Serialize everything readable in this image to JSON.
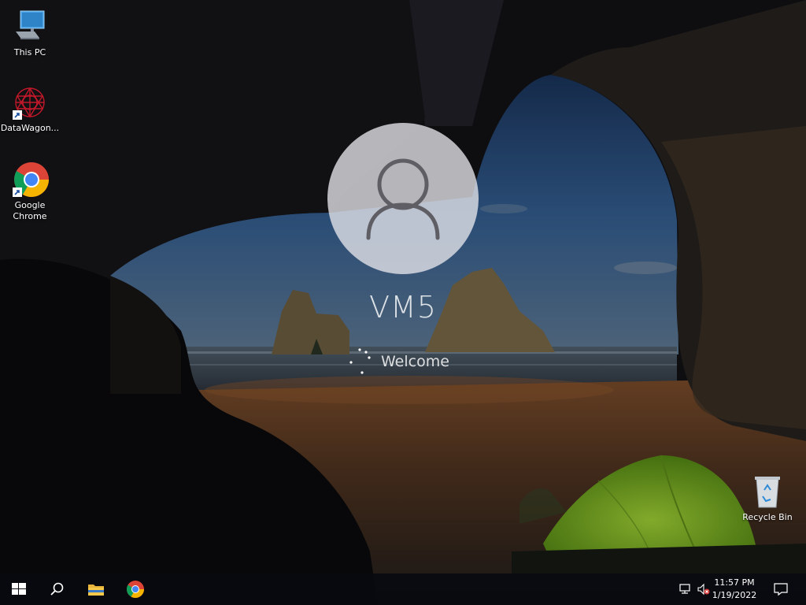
{
  "desktop": {
    "icons": [
      {
        "label": "This PC",
        "icon": "this-pc-icon"
      },
      {
        "label": "DataWagon...",
        "icon": "datawagon-icon"
      },
      {
        "label": "Google\nChrome",
        "icon": "chrome-icon"
      },
      {
        "label": "Recycle Bin",
        "icon": "recycle-bin-icon"
      }
    ]
  },
  "login": {
    "username": "VM5",
    "status": "Welcome"
  },
  "taskbar": {
    "start": "start-icon",
    "search": "search-icon",
    "pinned": [
      "file-explorer-icon",
      "chrome-icon"
    ],
    "tray": {
      "network": "network-icon",
      "volume": "volume-muted-icon",
      "time": "11:57 PM",
      "date": "1/19/2022",
      "notifications": "notification-icon"
    }
  },
  "colors": {
    "tent": "#8fd12a",
    "sky": "#3b6ea8",
    "taskbar": "#0a0c12"
  }
}
